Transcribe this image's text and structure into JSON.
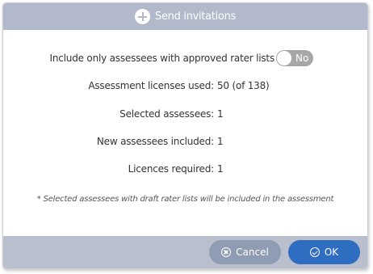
{
  "dialog": {
    "title": "Send invitations",
    "toggle": {
      "label": "Include only assessees with approved rater lists",
      "state_label": "No"
    },
    "rows": [
      {
        "label": "Assessment licenses used:",
        "value": "50 (of 138)"
      },
      {
        "label": "Selected assessees:",
        "value": "1"
      },
      {
        "label": "New assessees included:",
        "value": "1"
      },
      {
        "label": "Licences required:",
        "value": "1"
      }
    ],
    "note": "* Selected assessees with draft rater lists will be included in the assessment",
    "buttons": {
      "cancel": "Cancel",
      "ok": "OK"
    }
  },
  "colors": {
    "header": "#b1b9cb",
    "footer": "#b9bfcd",
    "cancel_button": "#8e9cb4",
    "ok_button": "#2f6dc0",
    "toggle_off": "#a7a7a7"
  },
  "icons": {
    "header": "plus-circle-icon",
    "cancel": "close-circle-icon",
    "ok": "check-circle-icon"
  }
}
